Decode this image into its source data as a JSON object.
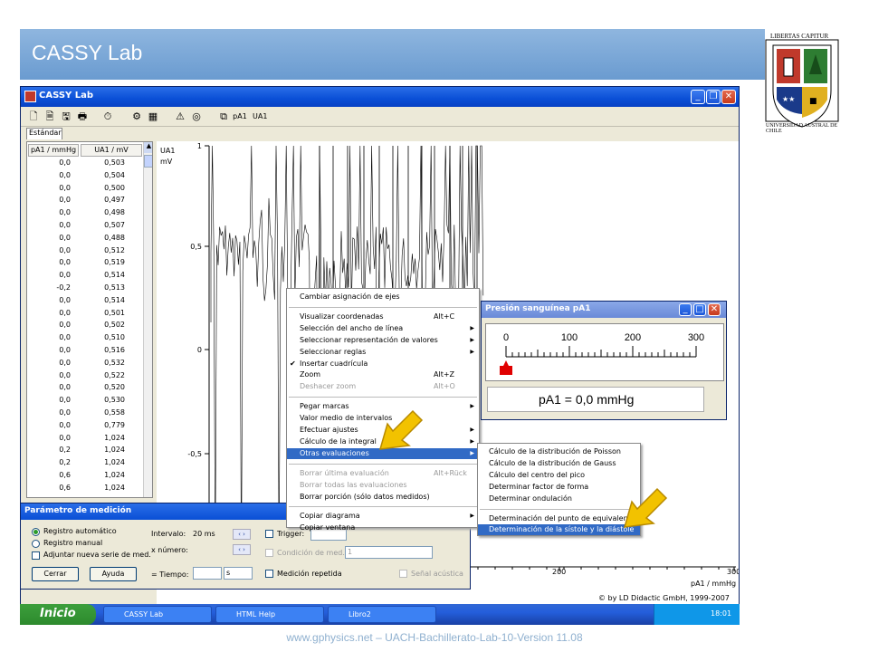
{
  "slide": {
    "title": "CASSY Lab",
    "footer": "www.gphysics.net – UACH-Bachillerato-Lab-10-Version 11.08"
  },
  "logo": {
    "motto": "LIBERTAS CAPITUR",
    "text": "UNIVERSIDAD AUSTRAL DE CHILE"
  },
  "window": {
    "title": "CASSY Lab",
    "tab": "Estándar"
  },
  "table": {
    "col1": "pA1 / mmHg",
    "col2": "UA1 / mV",
    "rows": [
      [
        "0,0",
        "0,503"
      ],
      [
        "0,0",
        "0,504"
      ],
      [
        "0,0",
        "0,500"
      ],
      [
        "0,0",
        "0,497"
      ],
      [
        "0,0",
        "0,498"
      ],
      [
        "0,0",
        "0,507"
      ],
      [
        "0,0",
        "0,488"
      ],
      [
        "0,0",
        "0,512"
      ],
      [
        "0,0",
        "0,519"
      ],
      [
        "0,0",
        "0,514"
      ],
      [
        "-0,2",
        "0,513"
      ],
      [
        "0,0",
        "0,514"
      ],
      [
        "0,0",
        "0,501"
      ],
      [
        "0,0",
        "0,502"
      ],
      [
        "0,0",
        "0,510"
      ],
      [
        "0,0",
        "0,516"
      ],
      [
        "0,0",
        "0,532"
      ],
      [
        "0,0",
        "0,522"
      ],
      [
        "0,0",
        "0,520"
      ],
      [
        "0,0",
        "0,530"
      ],
      [
        "0,0",
        "0,558"
      ],
      [
        "0,0",
        "0,779"
      ],
      [
        "0,0",
        "1,024"
      ],
      [
        "0,2",
        "1,024"
      ],
      [
        "0,2",
        "1,024"
      ],
      [
        "0,6",
        "1,024"
      ],
      [
        "0,6",
        "1,024"
      ]
    ]
  },
  "plot": {
    "ylabel": "UA1",
    "yunit": "mV",
    "xlabel": "pA1 / mmHg",
    "yticks": [
      "1",
      "0,5",
      "0",
      "-0,5"
    ],
    "xticks": [
      "200",
      "300"
    ],
    "copyright": "© by LD Didactic GmbH, 1999-2007"
  },
  "param": {
    "title": "Parámetro de medición",
    "radio_auto": "Registro automático",
    "radio_manual": "Registro manual",
    "chk_new": "Adjuntar nueva serie de med.",
    "close": "Cerrar",
    "help": "Ayuda",
    "interval_label": "Intervalo:",
    "interval_value": "20 ms",
    "xnum_label": "x número:",
    "time_label": "= Tiempo:",
    "time_unit": "s",
    "trigger": "Trigger:",
    "condition": "Condición de med.:",
    "condition_value": "1",
    "repeat": "Medición repetida",
    "acoustic": "Señal acústica"
  },
  "menu": {
    "items": [
      {
        "t": "Cambiar asignación de ejes"
      },
      {
        "t": "Visualizar coordenadas",
        "sc": "Alt+C"
      },
      {
        "t": "Selección del ancho de línea",
        "ar": true
      },
      {
        "t": "Seleccionar representación de valores",
        "ar": true
      },
      {
        "t": "Seleccionar reglas",
        "ar": true
      },
      {
        "t": "Insertar cuadrícula",
        "check": true
      },
      {
        "t": "Zoom",
        "sc": "Alt+Z"
      },
      {
        "t": "Deshacer zoom",
        "sc": "Alt+O",
        "dis": true
      },
      {
        "t": "Pegar marcas",
        "ar": true
      },
      {
        "t": "Valor medio de intervalos"
      },
      {
        "t": "Efectuar ajustes",
        "ar": true
      },
      {
        "t": "Cálculo de la integral",
        "ar": true
      },
      {
        "t": "Otras evaluaciones",
        "ar": true,
        "hl": true
      },
      {
        "t": "Borrar última evaluación",
        "sc": "Alt+Rück",
        "dis": true
      },
      {
        "t": "Borrar todas las evaluaciones",
        "dis": true
      },
      {
        "t": "Borrar porción (sólo datos medidos)"
      },
      {
        "t": "Copiar diagrama",
        "ar": true
      },
      {
        "t": "Copiar ventana"
      }
    ]
  },
  "submenu": {
    "items": [
      {
        "t": "Cálculo de la distribución de Poisson"
      },
      {
        "t": "Cálculo de la distribución de Gauss"
      },
      {
        "t": "Cálculo del centro del pico"
      },
      {
        "t": "Determinar factor de forma"
      },
      {
        "t": "Determinar ondulación"
      },
      {
        "t": "Determinación del punto de equivalencia"
      },
      {
        "t": "Determinación de la sístole y la diástole",
        "hl": true
      }
    ]
  },
  "gauge": {
    "title": "Presión sanguínea pA1",
    "ticks": [
      "0",
      "100",
      "200",
      "300"
    ],
    "value": 0,
    "max": 300,
    "readout": "pA1 = 0,0 mmHg"
  },
  "taskbar": {
    "start": "Inicio",
    "tasks": [
      "CASSY Lab",
      "HTML Help",
      "Libro2"
    ],
    "clock": "18:01"
  },
  "colors": {
    "arrow": "#f2c200",
    "highlight": "#316ac5",
    "title": "#0a4fd6"
  }
}
